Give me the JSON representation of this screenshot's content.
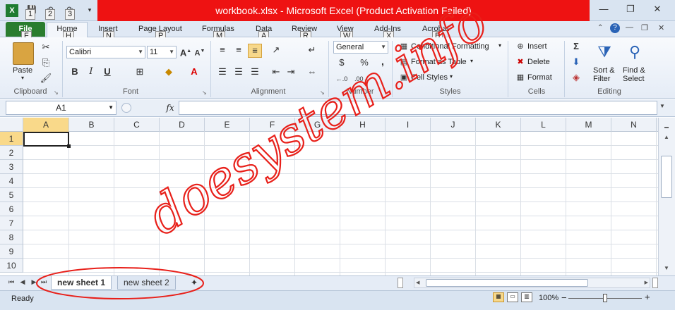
{
  "window": {
    "title": "workbook.xlsx - Microsoft Excel (Product Activation Failed)",
    "controls": {
      "minimize": "—",
      "restore": "❐",
      "close": "✕"
    }
  },
  "qat_keytips": [
    "1",
    "2",
    "3"
  ],
  "tabs": [
    {
      "label": "File",
      "key": "F"
    },
    {
      "label": "Home",
      "key": "H"
    },
    {
      "label": "Insert",
      "key": "N"
    },
    {
      "label": "Page Layout",
      "key": "P"
    },
    {
      "label": "Formulas",
      "key": "M"
    },
    {
      "label": "Data",
      "key": "A"
    },
    {
      "label": "Review",
      "key": "R"
    },
    {
      "label": "View",
      "key": "W"
    },
    {
      "label": "Add-Ins",
      "key": "X"
    },
    {
      "label": "Acrobat",
      "key": "B"
    }
  ],
  "ribbon": {
    "clipboard": {
      "label": "Clipboard",
      "paste": "Paste"
    },
    "font": {
      "label": "Font",
      "name": "Calibri",
      "size": "11",
      "bold": "B",
      "italic": "I",
      "underline": "U"
    },
    "alignment": {
      "label": "Alignment"
    },
    "number": {
      "label": "Number",
      "format": "General",
      "currency": "$",
      "percent": "%",
      "comma": ","
    },
    "styles": {
      "label": "Styles",
      "conditional": "Conditional Formatting",
      "table": "Format as Table",
      "cell": "Cell Styles"
    },
    "cells": {
      "label": "Cells",
      "insert": "Insert",
      "delete": "Delete",
      "format": "Format"
    },
    "editing": {
      "label": "Editing",
      "sum": "Σ",
      "sort": "Sort &",
      "filter": "Filter",
      "find": "Find &",
      "select": "Select"
    }
  },
  "formula_bar": {
    "name_box": "A1",
    "fx": "fx",
    "value": ""
  },
  "columns": [
    "A",
    "B",
    "C",
    "D",
    "E",
    "F",
    "G",
    "H",
    "I",
    "J",
    "K",
    "L",
    "M",
    "N"
  ],
  "rows": [
    "1",
    "2",
    "3",
    "4",
    "5",
    "6",
    "7",
    "8",
    "9",
    "10"
  ],
  "sheets": [
    {
      "label": "new sheet 1",
      "active": true
    },
    {
      "label": "new sheet 2",
      "active": false
    }
  ],
  "status": {
    "text": "Ready",
    "zoom": "100%",
    "zoom_minus": "−",
    "zoom_plus": "+",
    "zoom_level": 1.0
  },
  "watermark": {
    "text": "doesystem.info",
    "color": "#e8201a"
  }
}
